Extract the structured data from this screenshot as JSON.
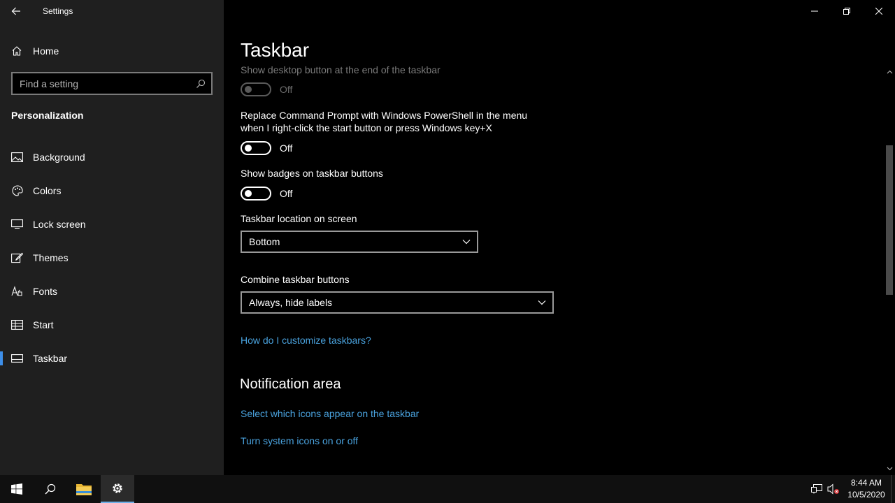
{
  "window": {
    "title": "Settings"
  },
  "sidebar": {
    "home_label": "Home",
    "search_placeholder": "Find a setting",
    "section_title": "Personalization",
    "items": [
      {
        "label": "Background",
        "icon": "picture-icon"
      },
      {
        "label": "Colors",
        "icon": "palette-icon"
      },
      {
        "label": "Lock screen",
        "icon": "lock-screen-icon"
      },
      {
        "label": "Themes",
        "icon": "brush-icon"
      },
      {
        "label": "Fonts",
        "icon": "font-icon"
      },
      {
        "label": "Start",
        "icon": "start-icon"
      },
      {
        "label": "Taskbar",
        "icon": "taskbar-icon",
        "active": true
      }
    ]
  },
  "main": {
    "page_title": "Taskbar",
    "settings": {
      "show_desktop": {
        "label": "Show desktop button at the end of the taskbar",
        "state": "Off",
        "enabled": false
      },
      "powershell": {
        "label": "Replace Command Prompt with Windows PowerShell in the menu when I right-click the start button or press Windows key+X",
        "state": "Off"
      },
      "badges": {
        "label": "Show badges on taskbar buttons",
        "state": "Off"
      },
      "location": {
        "label": "Taskbar location on screen",
        "value": "Bottom"
      },
      "combine": {
        "label": "Combine taskbar buttons",
        "value": "Always, hide labels"
      }
    },
    "help_link": "How do I customize taskbars?",
    "notification_area": {
      "header": "Notification area",
      "links": [
        "Select which icons appear on the taskbar",
        "Turn system icons on or off"
      ]
    }
  },
  "taskbar": {
    "time": "8:44 AM",
    "date": "10/5/2020"
  },
  "colors": {
    "accent": "#3d8ee8",
    "link": "#4aa3df",
    "sidebar_bg": "#1f1f1f",
    "taskbar_bg": "#101010"
  }
}
